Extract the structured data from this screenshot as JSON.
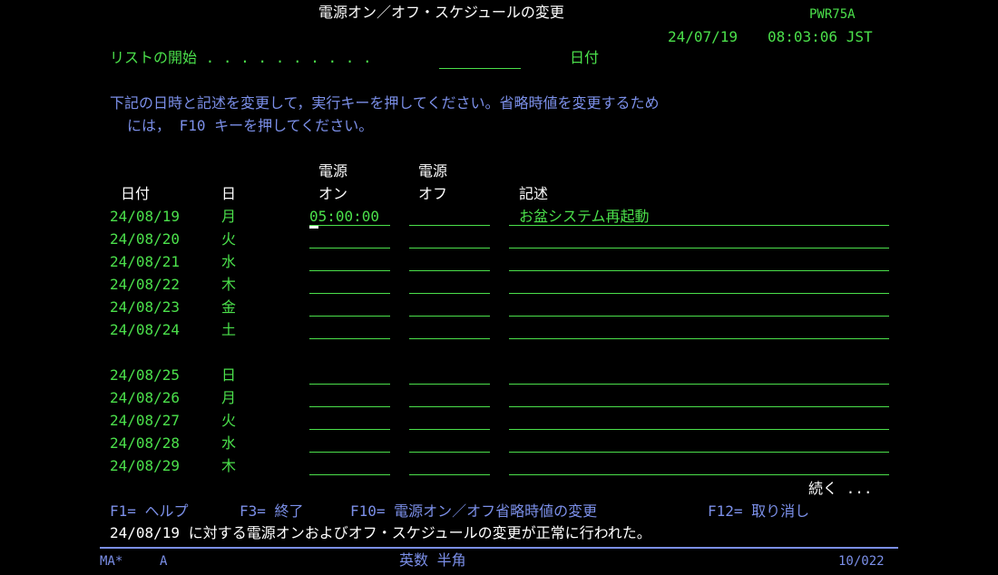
{
  "header": {
    "title": "電源オン／オフ・スケジュールの変更",
    "program": "PWR75A",
    "date": "24/07/19",
    "time": "08:03:06 JST"
  },
  "list_start": {
    "label": "リストの開始 . . . . . . . . . .",
    "value": "",
    "suffix": "日付"
  },
  "instructions": {
    "line1": "下記の日時と記述を変更して，実行キーを押してください。省略時値を変更するため",
    "line2": "には， F10 キーを押してください。"
  },
  "columns": {
    "date": "日付",
    "day": "日",
    "power_on_top": "電源",
    "power_on_bottom": "オン",
    "power_off_top": "電源",
    "power_off_bottom": "オフ",
    "description": "記述"
  },
  "rows": [
    {
      "date": "24/08/19",
      "day": "月",
      "on": "05:00:00",
      "off": "",
      "desc": "お盆システム再起動"
    },
    {
      "date": "24/08/20",
      "day": "火",
      "on": "",
      "off": "",
      "desc": ""
    },
    {
      "date": "24/08/21",
      "day": "水",
      "on": "",
      "off": "",
      "desc": ""
    },
    {
      "date": "24/08/22",
      "day": "木",
      "on": "",
      "off": "",
      "desc": ""
    },
    {
      "date": "24/08/23",
      "day": "金",
      "on": "",
      "off": "",
      "desc": ""
    },
    {
      "date": "24/08/24",
      "day": "土",
      "on": "",
      "off": "",
      "desc": ""
    },
    {
      "date": "24/08/25",
      "day": "日",
      "on": "",
      "off": "",
      "desc": ""
    },
    {
      "date": "24/08/26",
      "day": "月",
      "on": "",
      "off": "",
      "desc": ""
    },
    {
      "date": "24/08/27",
      "day": "火",
      "on": "",
      "off": "",
      "desc": ""
    },
    {
      "date": "24/08/28",
      "day": "水",
      "on": "",
      "off": "",
      "desc": ""
    },
    {
      "date": "24/08/29",
      "day": "木",
      "on": "",
      "off": "",
      "desc": ""
    }
  ],
  "more": "続く ...",
  "function_keys": {
    "f1": "F1= ヘルプ",
    "f3": "F3= 終了",
    "f10": "F10= 電源オン／オフ省略時値の変更",
    "f12": "F12= 取り消し"
  },
  "message": "24/08/19 に対する電源オンおよびオフ・スケジュールの変更が正常に行われた。",
  "status_bar": {
    "session": "MA*",
    "mode": "A",
    "input_mode": "英数 半角",
    "cursor_pos": "10/022"
  }
}
